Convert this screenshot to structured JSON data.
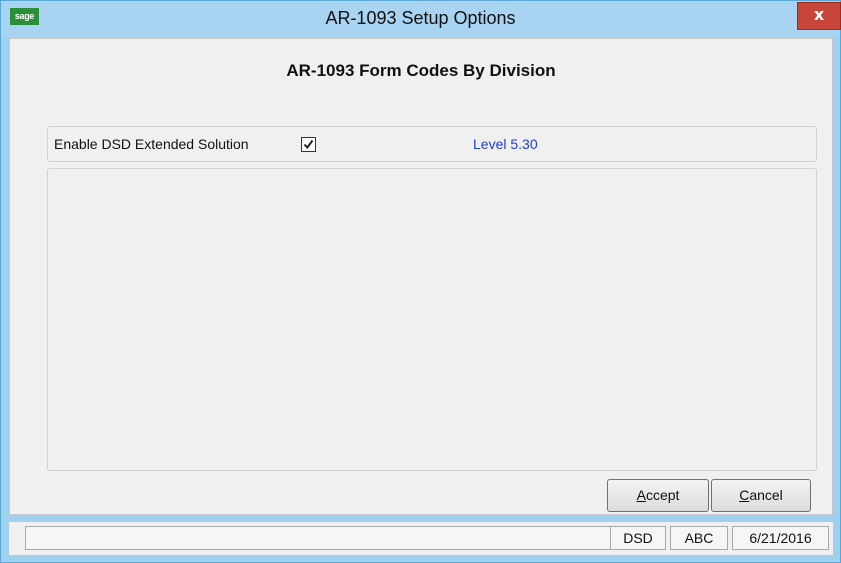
{
  "window": {
    "title": "AR-1093  Setup Options",
    "app_icon_text": "sage",
    "close_label": "x"
  },
  "form": {
    "heading": "AR-1093 Form Codes By Division",
    "enable_label": "Enable DSD Extended Solution",
    "enable_checked": true,
    "level_text": "Level  5.30"
  },
  "buttons": {
    "accept_first": "A",
    "accept_rest": "ccept",
    "cancel_first": "C",
    "cancel_rest": "ancel"
  },
  "statusbar": {
    "message": "",
    "company_code": "DSD",
    "company": "ABC",
    "date": "6/21/2016"
  },
  "colors": {
    "title_bar": "#a8d4f1",
    "close_button": "#c8453a",
    "level_text": "#1c3fd6",
    "app_icon": "#2b8f3a"
  }
}
